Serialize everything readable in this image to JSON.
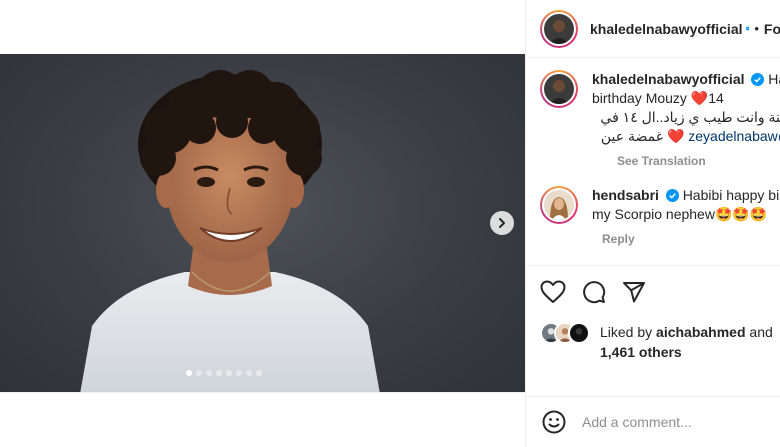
{
  "header": {
    "username": "khaledelnabawyofficial",
    "separator": "•",
    "follow_label": "Fo"
  },
  "caption": {
    "username": "khaledelnabawyofficial",
    "line1_rest": "Hap",
    "line2": "birthday Mouzy",
    "line2_heart": "❤️",
    "line2_number": "14",
    "line3": "سنة وانت طيب ي زياد..ال ١٤ في",
    "line4_mention": "@zeyadelnabaw",
    "line4_text": "غمضة عين",
    "line4_heart": "❤️",
    "see_translation": "See Translation"
  },
  "comment": {
    "username": "hendsabri",
    "line1_rest": "Habibi happy birt",
    "line2": "my Scorpio nephew",
    "emojis": "🤩🤩🤩",
    "reply_label": "Reply"
  },
  "likes": {
    "prefix": "Liked by",
    "user": "aichabahmed",
    "and": "and",
    "others": "1,461 others"
  },
  "add_comment": {
    "placeholder": "Add a comment..."
  },
  "carousel": {
    "slide_count": 8,
    "active_index": 0
  },
  "colors": {
    "verified": "#0095f6",
    "heart": "#ed1c24",
    "mention": "#00376b",
    "muted": "#8e8e8e"
  },
  "icons": [
    "verified-badge-icon",
    "chevron-right-icon",
    "heart-icon",
    "comment-icon",
    "share-icon",
    "emoji-icon"
  ]
}
